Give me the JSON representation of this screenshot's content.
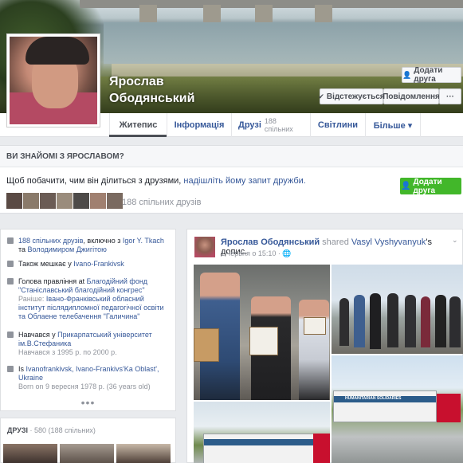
{
  "profile": {
    "name": "Ярослав Ободянський"
  },
  "cover_actions": {
    "add_friend": "Додати друга",
    "following": "Відстежується",
    "message": "Повідомлення",
    "more": "···"
  },
  "tabs": [
    {
      "label": "Житепис",
      "active": true
    },
    {
      "label": "Інформація"
    },
    {
      "label": "Друзі",
      "count": "188 спільних"
    },
    {
      "label": "Світлини"
    },
    {
      "label": "Більше ▾"
    }
  ],
  "know_box": {
    "heading": "ВИ ЗНАЙОМІ З ЯРОСЛАВОМ?",
    "text_prefix": "Щоб побачити, чим він ділиться з друзями, ",
    "text_link": "надішліть йому запит дружби.",
    "add_friend": "Додати друга",
    "mutual_count": "188 спільних друзів"
  },
  "intro": {
    "mutual": {
      "link": "188 спільних друзів",
      "mid": ", включно з ",
      "friend1": "Igor Y. Tkach",
      "and": " та ",
      "friend2": "Володимиром Джигітою"
    },
    "lives": {
      "prefix": "Також мешкає у ",
      "place": "Ivano-Frankivsk"
    },
    "work": {
      "prefix": "Голова правління at ",
      "org": "Благодійний фонд \"Станіславський благодійний конгрес\"",
      "prev_label": "Раніше: ",
      "prev": "Івано-Франківський обласний інститут післядипломної педагогічної освіти та Облаене телебачення \"Галичина\""
    },
    "study": {
      "prefix": "Навчався у ",
      "school": "Прикарпатський університет ім.В.Стефаника",
      "years": "Навчався з 1995 р. по 2000 р."
    },
    "born": {
      "prefix": "Is ",
      "place": "Ivanofrankivsk, Ivano-Frankivs'Ka Oblast', Ukraine",
      "date": "Born on 9 вересня 1978 р. (36 years old)"
    },
    "more": "•••"
  },
  "friends_box": {
    "label": "ДРУЗІ",
    "count": " · 580 (188 спільних)"
  },
  "post": {
    "author": "Ярослав Ободянський",
    "shared": " shared ",
    "source": "Vasyl Vyshyvanyuk",
    "suffix": "'s допис.",
    "date": "1 червня о 15:10 · ",
    "privacy_icon": "globe-icon",
    "truck_text": "HUMANITARIAN SOLIDARIES"
  }
}
